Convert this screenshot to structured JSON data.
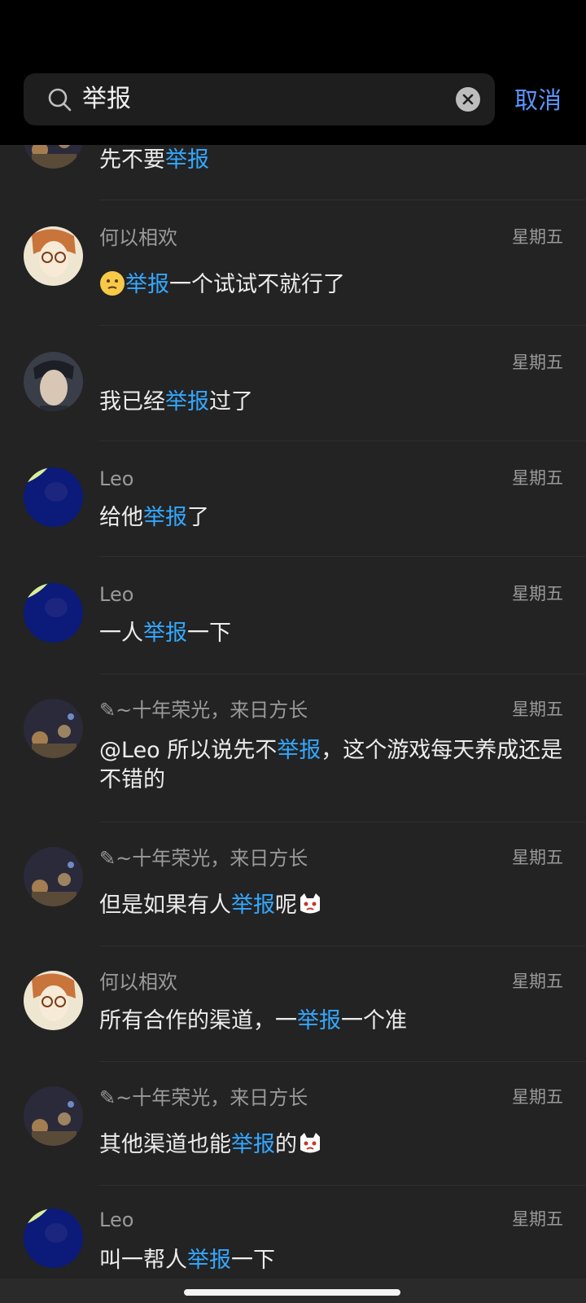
{
  "search": {
    "query": "举报",
    "cancel_label": "取消"
  },
  "messages": [
    {
      "name": "",
      "time": "",
      "pre": "先不要",
      "hl": "举报",
      "post": "",
      "avatar": "city"
    },
    {
      "name": "何以相欢",
      "time": "星期五",
      "pre": "",
      "hl": "举报",
      "post": "一个试试不就行了",
      "avatar": "glasses",
      "emoji_before": "smiley-emoji"
    },
    {
      "name": "",
      "time": "星期五",
      "pre": "我已经",
      "hl": "举报",
      "post": "过了",
      "avatar": "man"
    },
    {
      "name": "Leo",
      "time": "星期五",
      "pre": "给他",
      "hl": "举报",
      "post": "了",
      "avatar": "blue"
    },
    {
      "name": "Leo",
      "time": "星期五",
      "pre": "一人",
      "hl": "举报",
      "post": "一下",
      "avatar": "blue"
    },
    {
      "name": "✎~十年荣光，来日方长",
      "time": "星期五",
      "pre": "@Leo  所以说先不",
      "hl": "举报",
      "post": "，这个游戏每天养成还是不错的",
      "avatar": "city"
    },
    {
      "name": "✎~十年荣光，来日方长",
      "time": "星期五",
      "pre": "但是如果有人",
      "hl": "举报",
      "post": "呢",
      "avatar": "city",
      "emoji_after": "cat-emoji"
    },
    {
      "name": "何以相欢",
      "time": "星期五",
      "pre": "所有合作的渠道，一",
      "hl": "举报",
      "post": "一个准",
      "avatar": "glasses"
    },
    {
      "name": "✎~十年荣光，来日方长",
      "time": "星期五",
      "pre": "其他渠道也能",
      "hl": "举报",
      "post": "的",
      "avatar": "city",
      "emoji_after": "cat-emoji"
    },
    {
      "name": "Leo",
      "time": "星期五",
      "pre": "叫一帮人",
      "hl": "举报",
      "post": "一下",
      "avatar": "blue"
    }
  ]
}
